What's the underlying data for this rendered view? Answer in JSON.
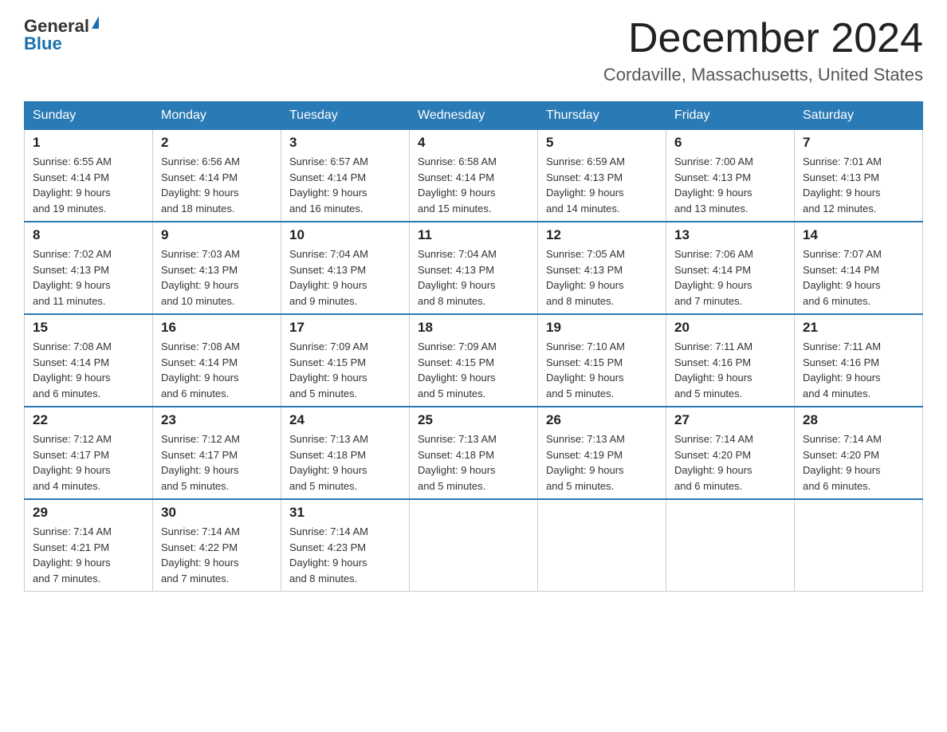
{
  "header": {
    "logo_general": "General",
    "logo_blue": "Blue",
    "title": "December 2024",
    "subtitle": "Cordaville, Massachusetts, United States"
  },
  "days_of_week": [
    "Sunday",
    "Monday",
    "Tuesday",
    "Wednesday",
    "Thursday",
    "Friday",
    "Saturday"
  ],
  "weeks": [
    [
      {
        "day": "1",
        "sunrise": "Sunrise: 6:55 AM",
        "sunset": "Sunset: 4:14 PM",
        "daylight": "Daylight: 9 hours",
        "daylight2": "and 19 minutes."
      },
      {
        "day": "2",
        "sunrise": "Sunrise: 6:56 AM",
        "sunset": "Sunset: 4:14 PM",
        "daylight": "Daylight: 9 hours",
        "daylight2": "and 18 minutes."
      },
      {
        "day": "3",
        "sunrise": "Sunrise: 6:57 AM",
        "sunset": "Sunset: 4:14 PM",
        "daylight": "Daylight: 9 hours",
        "daylight2": "and 16 minutes."
      },
      {
        "day": "4",
        "sunrise": "Sunrise: 6:58 AM",
        "sunset": "Sunset: 4:14 PM",
        "daylight": "Daylight: 9 hours",
        "daylight2": "and 15 minutes."
      },
      {
        "day": "5",
        "sunrise": "Sunrise: 6:59 AM",
        "sunset": "Sunset: 4:13 PM",
        "daylight": "Daylight: 9 hours",
        "daylight2": "and 14 minutes."
      },
      {
        "day": "6",
        "sunrise": "Sunrise: 7:00 AM",
        "sunset": "Sunset: 4:13 PM",
        "daylight": "Daylight: 9 hours",
        "daylight2": "and 13 minutes."
      },
      {
        "day": "7",
        "sunrise": "Sunrise: 7:01 AM",
        "sunset": "Sunset: 4:13 PM",
        "daylight": "Daylight: 9 hours",
        "daylight2": "and 12 minutes."
      }
    ],
    [
      {
        "day": "8",
        "sunrise": "Sunrise: 7:02 AM",
        "sunset": "Sunset: 4:13 PM",
        "daylight": "Daylight: 9 hours",
        "daylight2": "and 11 minutes."
      },
      {
        "day": "9",
        "sunrise": "Sunrise: 7:03 AM",
        "sunset": "Sunset: 4:13 PM",
        "daylight": "Daylight: 9 hours",
        "daylight2": "and 10 minutes."
      },
      {
        "day": "10",
        "sunrise": "Sunrise: 7:04 AM",
        "sunset": "Sunset: 4:13 PM",
        "daylight": "Daylight: 9 hours",
        "daylight2": "and 9 minutes."
      },
      {
        "day": "11",
        "sunrise": "Sunrise: 7:04 AM",
        "sunset": "Sunset: 4:13 PM",
        "daylight": "Daylight: 9 hours",
        "daylight2": "and 8 minutes."
      },
      {
        "day": "12",
        "sunrise": "Sunrise: 7:05 AM",
        "sunset": "Sunset: 4:13 PM",
        "daylight": "Daylight: 9 hours",
        "daylight2": "and 8 minutes."
      },
      {
        "day": "13",
        "sunrise": "Sunrise: 7:06 AM",
        "sunset": "Sunset: 4:14 PM",
        "daylight": "Daylight: 9 hours",
        "daylight2": "and 7 minutes."
      },
      {
        "day": "14",
        "sunrise": "Sunrise: 7:07 AM",
        "sunset": "Sunset: 4:14 PM",
        "daylight": "Daylight: 9 hours",
        "daylight2": "and 6 minutes."
      }
    ],
    [
      {
        "day": "15",
        "sunrise": "Sunrise: 7:08 AM",
        "sunset": "Sunset: 4:14 PM",
        "daylight": "Daylight: 9 hours",
        "daylight2": "and 6 minutes."
      },
      {
        "day": "16",
        "sunrise": "Sunrise: 7:08 AM",
        "sunset": "Sunset: 4:14 PM",
        "daylight": "Daylight: 9 hours",
        "daylight2": "and 6 minutes."
      },
      {
        "day": "17",
        "sunrise": "Sunrise: 7:09 AM",
        "sunset": "Sunset: 4:15 PM",
        "daylight": "Daylight: 9 hours",
        "daylight2": "and 5 minutes."
      },
      {
        "day": "18",
        "sunrise": "Sunrise: 7:09 AM",
        "sunset": "Sunset: 4:15 PM",
        "daylight": "Daylight: 9 hours",
        "daylight2": "and 5 minutes."
      },
      {
        "day": "19",
        "sunrise": "Sunrise: 7:10 AM",
        "sunset": "Sunset: 4:15 PM",
        "daylight": "Daylight: 9 hours",
        "daylight2": "and 5 minutes."
      },
      {
        "day": "20",
        "sunrise": "Sunrise: 7:11 AM",
        "sunset": "Sunset: 4:16 PM",
        "daylight": "Daylight: 9 hours",
        "daylight2": "and 5 minutes."
      },
      {
        "day": "21",
        "sunrise": "Sunrise: 7:11 AM",
        "sunset": "Sunset: 4:16 PM",
        "daylight": "Daylight: 9 hours",
        "daylight2": "and 4 minutes."
      }
    ],
    [
      {
        "day": "22",
        "sunrise": "Sunrise: 7:12 AM",
        "sunset": "Sunset: 4:17 PM",
        "daylight": "Daylight: 9 hours",
        "daylight2": "and 4 minutes."
      },
      {
        "day": "23",
        "sunrise": "Sunrise: 7:12 AM",
        "sunset": "Sunset: 4:17 PM",
        "daylight": "Daylight: 9 hours",
        "daylight2": "and 5 minutes."
      },
      {
        "day": "24",
        "sunrise": "Sunrise: 7:13 AM",
        "sunset": "Sunset: 4:18 PM",
        "daylight": "Daylight: 9 hours",
        "daylight2": "and 5 minutes."
      },
      {
        "day": "25",
        "sunrise": "Sunrise: 7:13 AM",
        "sunset": "Sunset: 4:18 PM",
        "daylight": "Daylight: 9 hours",
        "daylight2": "and 5 minutes."
      },
      {
        "day": "26",
        "sunrise": "Sunrise: 7:13 AM",
        "sunset": "Sunset: 4:19 PM",
        "daylight": "Daylight: 9 hours",
        "daylight2": "and 5 minutes."
      },
      {
        "day": "27",
        "sunrise": "Sunrise: 7:14 AM",
        "sunset": "Sunset: 4:20 PM",
        "daylight": "Daylight: 9 hours",
        "daylight2": "and 6 minutes."
      },
      {
        "day": "28",
        "sunrise": "Sunrise: 7:14 AM",
        "sunset": "Sunset: 4:20 PM",
        "daylight": "Daylight: 9 hours",
        "daylight2": "and 6 minutes."
      }
    ],
    [
      {
        "day": "29",
        "sunrise": "Sunrise: 7:14 AM",
        "sunset": "Sunset: 4:21 PM",
        "daylight": "Daylight: 9 hours",
        "daylight2": "and 7 minutes."
      },
      {
        "day": "30",
        "sunrise": "Sunrise: 7:14 AM",
        "sunset": "Sunset: 4:22 PM",
        "daylight": "Daylight: 9 hours",
        "daylight2": "and 7 minutes."
      },
      {
        "day": "31",
        "sunrise": "Sunrise: 7:14 AM",
        "sunset": "Sunset: 4:23 PM",
        "daylight": "Daylight: 9 hours",
        "daylight2": "and 8 minutes."
      },
      null,
      null,
      null,
      null
    ]
  ]
}
